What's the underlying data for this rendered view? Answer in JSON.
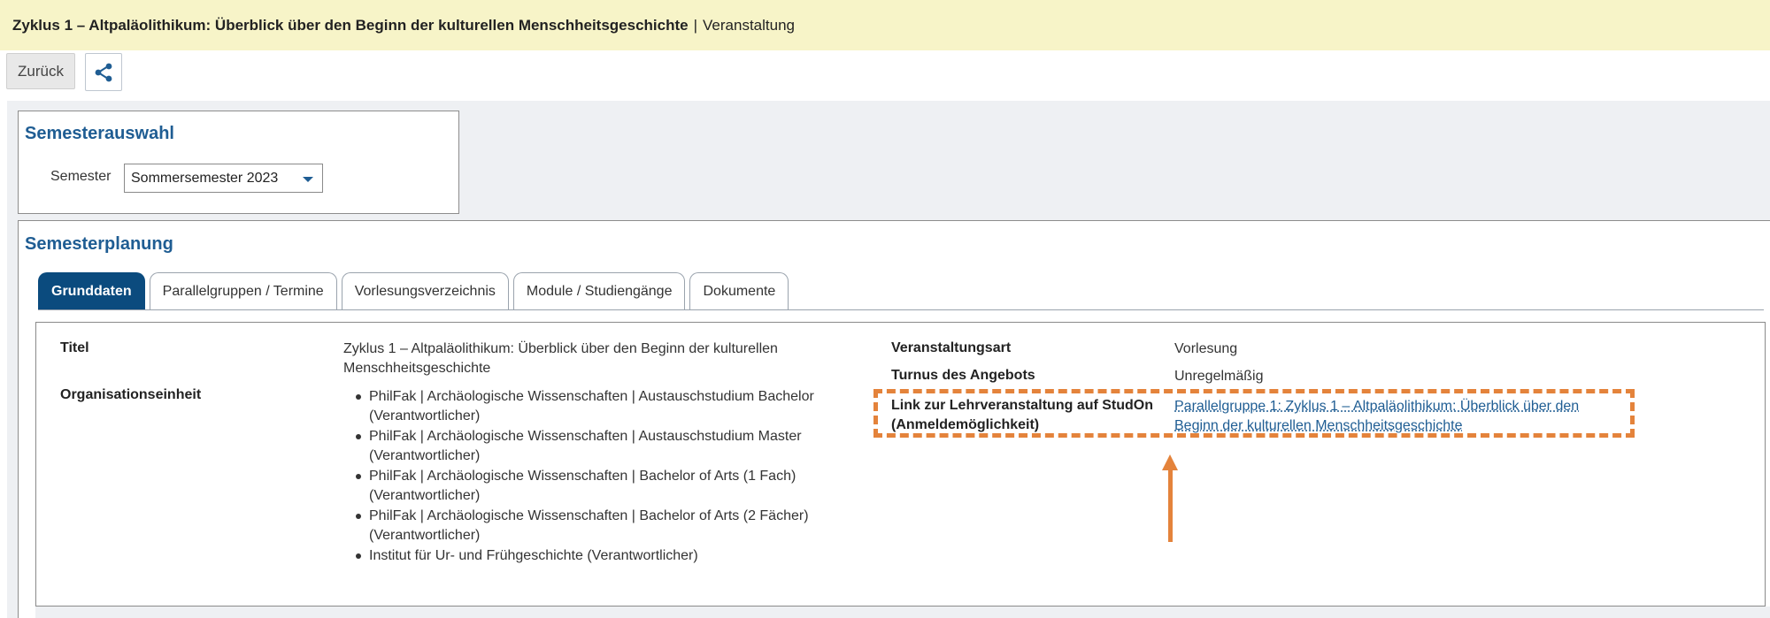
{
  "titlebar": {
    "title": "Zyklus 1 – Altpaläolithikum: Überblick über den Beginn der kulturellen Menschheitsgeschichte",
    "separator": "|",
    "type": "Veranstaltung"
  },
  "toolbar": {
    "back_label": "Zurück",
    "share_icon": "share-icon"
  },
  "semesterauswahl": {
    "heading": "Semesterauswahl",
    "semester_label": "Semester",
    "semester_value": "Sommersemester 2023"
  },
  "semesterplanung": {
    "heading": "Semesterplanung",
    "tabs": [
      {
        "label": "Grunddaten",
        "active": true
      },
      {
        "label": "Parallelgruppen / Termine",
        "active": false
      },
      {
        "label": "Vorlesungsverzeichnis",
        "active": false
      },
      {
        "label": "Module / Studiengänge",
        "active": false
      },
      {
        "label": "Dokumente",
        "active": false
      }
    ]
  },
  "grunddaten": {
    "titel_label": "Titel",
    "titel_value": "Zyklus 1 – Altpaläolithikum: Überblick über den Beginn der kulturellen Menschheitsgeschichte",
    "org_label": "Organisationseinheit",
    "org_items": [
      "PhilFak | Archäologische Wissenschaften | Austauschstudium Bachelor (Verantwortlicher)",
      "PhilFak | Archäologische Wissenschaften | Austauschstudium Master (Verantwortlicher)",
      "PhilFak | Archäologische Wissenschaften | Bachelor of Arts (1 Fach) (Verantwortlicher)",
      "PhilFak | Archäologische Wissenschaften | Bachelor of Arts (2 Fächer) (Verantwortlicher)",
      "Institut für Ur- und Frühgeschichte (Verantwortlicher)"
    ],
    "art_label": "Veranstaltungsart",
    "art_value": "Vorlesung",
    "turnus_label": "Turnus des Angebots",
    "turnus_value": "Unregelmäßig",
    "link_label": "Link zur Lehrveranstaltung auf StudOn (Anmeldemöglichkeit)",
    "link_value": "Parallelgruppe 1: Zyklus 1 – Altpaläolithikum: Überblick über den Beginn der kulturellen Menschheitsgeschichte"
  },
  "colors": {
    "titlebar_bg": "#f7f4c8",
    "heading_blue": "#1f5d93",
    "active_tab": "#0b4b7e",
    "annotation_orange": "#e4833b"
  }
}
